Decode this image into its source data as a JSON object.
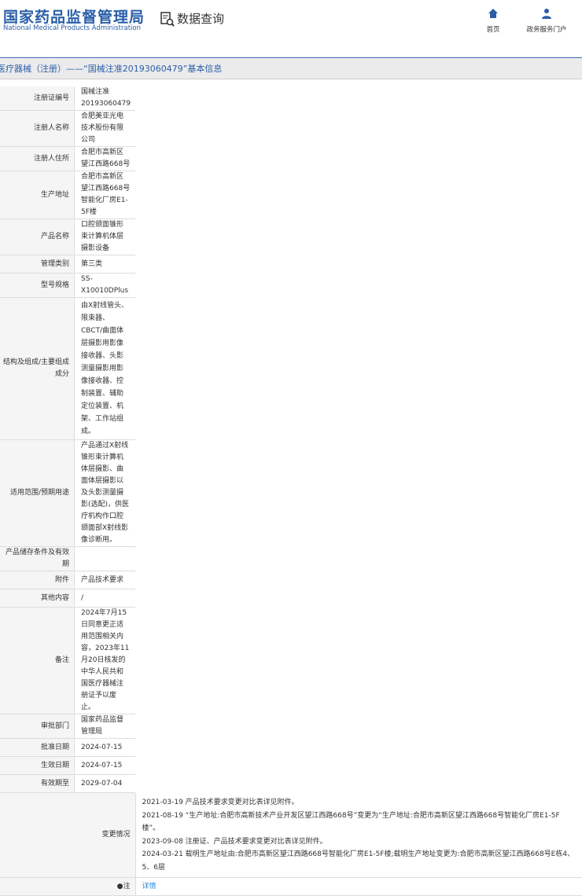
{
  "header": {
    "logo_cn": "国家药品监督管理局",
    "logo_en": "National Medical Products Administration",
    "query_label": "数据查询",
    "nav": [
      {
        "label": "首页",
        "icon": "home-icon"
      },
      {
        "label": "政务服务门户",
        "icon": "user-icon"
      }
    ]
  },
  "breadcrumb": "医疗器械（注册）——“国械注准20193060479”基本信息",
  "rows": [
    {
      "label": "注册证编号",
      "value": "国械注准20193060479"
    },
    {
      "label": "注册人名称",
      "value": "合肥美亚光电技术股份有限公司"
    },
    {
      "label": "注册人住所",
      "value": "合肥市高新区望江西路668号"
    },
    {
      "label": "生产地址",
      "value": "合肥市高新区望江西路668号智能化厂房E1-5F楼"
    },
    {
      "label": "产品名称",
      "value": "口腔颌面锥形束计算机体层摄影设备"
    },
    {
      "label": "管理类别",
      "value": "第三类"
    },
    {
      "label": "型号规格",
      "value": "SS-X10010DPlus"
    },
    {
      "label": "结构及组成/主要组成成分",
      "value": "由X射线管头、限束器、CBCT/曲面体层摄影用影像接收器、头影测量摄影用影像接收器、控制装置、辅助定位装置、机架、工作站组成。"
    },
    {
      "label": "适用范围/预期用途",
      "value": "产品通过X射线锥形束计算机体层摄影、曲面体层摄影以及头影测量摄影(选配)，供医疗机构作口腔颌面部X射线影像诊断用。"
    },
    {
      "label": "产品储存条件及有效期",
      "value": ""
    },
    {
      "label": "附件",
      "value": "产品技术要求"
    },
    {
      "label": "其他内容",
      "value": "/"
    },
    {
      "label": "备注",
      "value": "2024年7月15日同意更正适用范围相关内容，2023年11月20日核发的中华人民共和国医疗器械注册证予以废止。"
    },
    {
      "label": "审批部门",
      "value": "国家药品监督管理局"
    },
    {
      "label": "批准日期",
      "value": "2024-07-15"
    },
    {
      "label": "生效日期",
      "value": "2024-07-15"
    },
    {
      "label": "有效期至",
      "value": "2029-07-04"
    }
  ],
  "changes": {
    "label": "变更情况",
    "items": [
      "2021-03-19 产品技术要求变更对比表详见附件。",
      "2021-08-19 “生产地址:合肥市高新技术产业开发区望江西路668号”变更为“生产地址:合肥市高新区望江西路668号智能化厂房E1-5F楼”。",
      "2023-09-08 注册证、产品技术要求变更对比表详见附件。",
      "2024-03-21 载明生产地址由:合肥市高新区望江西路668号智能化厂房E1-5F楼;载明生产地址变更为:合肥市高新区望江西路668号E栋4、5、6层"
    ]
  },
  "note": {
    "label": "注",
    "link": "详情"
  }
}
